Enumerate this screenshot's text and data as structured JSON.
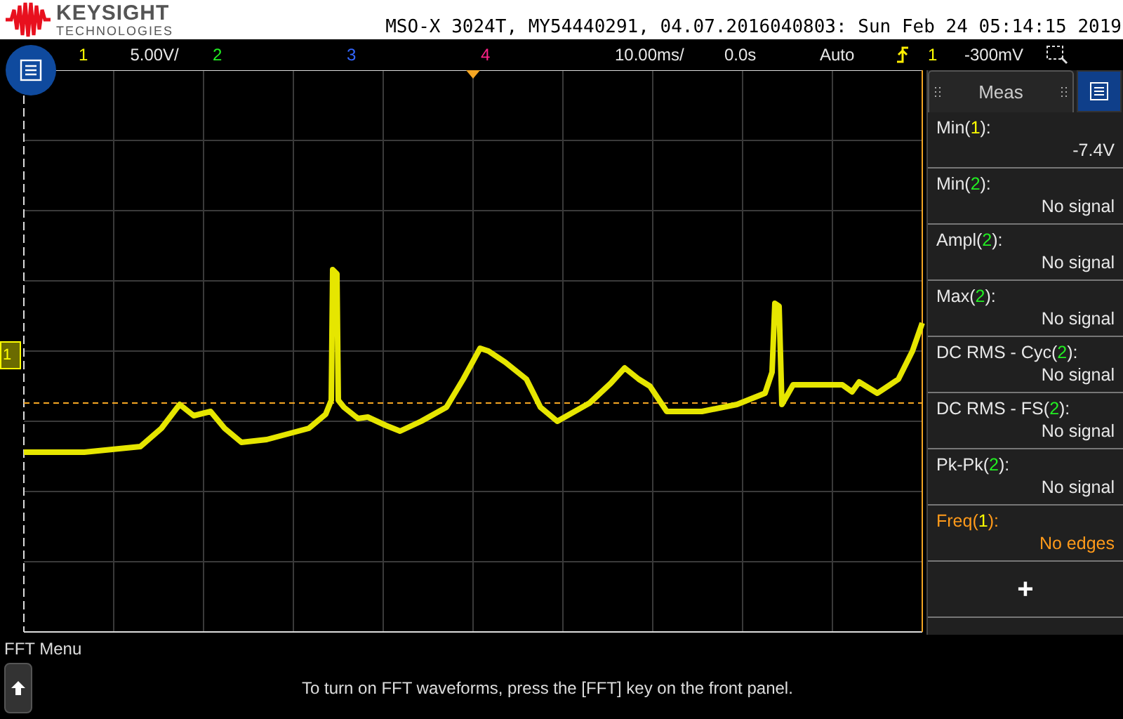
{
  "header": {
    "brand": "KEYSIGHT",
    "brand_sub": "TECHNOLOGIES",
    "title": "MSO-X 3024T, MY54440291, 04.07.2016040803: Sun Feb 24 05:14:15 2019"
  },
  "status_bar": {
    "channels": [
      {
        "number": "1",
        "scale": "5.00V/",
        "color": "#ffff00"
      },
      {
        "number": "2",
        "color": "#22ee22"
      },
      {
        "number": "3",
        "color": "#3366ff"
      },
      {
        "number": "4",
        "color": "#ff2288"
      }
    ],
    "timebase": "10.00ms/",
    "delay": "0.0s",
    "trigger_mode": "Auto",
    "trigger_source": "1",
    "trigger_level": "-300mV"
  },
  "display": {
    "channel_marker": "1"
  },
  "meas_panel": {
    "tab": "Meas",
    "items": [
      {
        "label_before": "Min(",
        "channel": "1",
        "label_after": "):",
        "color": "#ffff00",
        "value": "-7.4V",
        "kind": "normal"
      },
      {
        "label_before": "Min(",
        "channel": "2",
        "label_after": "):",
        "color": "#22ee22",
        "value": "No signal",
        "kind": "normal"
      },
      {
        "label_before": "Ampl(",
        "channel": "2",
        "label_after": "):",
        "color": "#22ee22",
        "value": "No signal",
        "kind": "normal"
      },
      {
        "label_before": "Max(",
        "channel": "2",
        "label_after": "):",
        "color": "#22ee22",
        "value": "No signal",
        "kind": "normal"
      },
      {
        "label_before": "DC RMS - Cyc(",
        "channel": "2",
        "label_after": "):",
        "color": "#22ee22",
        "value": "No signal",
        "kind": "normal"
      },
      {
        "label_before": "DC RMS - FS(",
        "channel": "2",
        "label_after": "):",
        "color": "#22ee22",
        "value": "No signal",
        "kind": "normal"
      },
      {
        "label_before": "Pk-Pk(",
        "channel": "2",
        "label_after": "):",
        "color": "#22ee22",
        "value": "No signal",
        "kind": "normal"
      },
      {
        "label_before": "Freq(",
        "channel": "1",
        "label_after": "):",
        "color": "#ffff00",
        "value": "No edges",
        "kind": "warning"
      }
    ],
    "add_button": "+"
  },
  "softkey_menu": {
    "title": "FFT Menu",
    "message": "To turn on FFT waveforms, press the [FFT] key on the front panel."
  }
}
